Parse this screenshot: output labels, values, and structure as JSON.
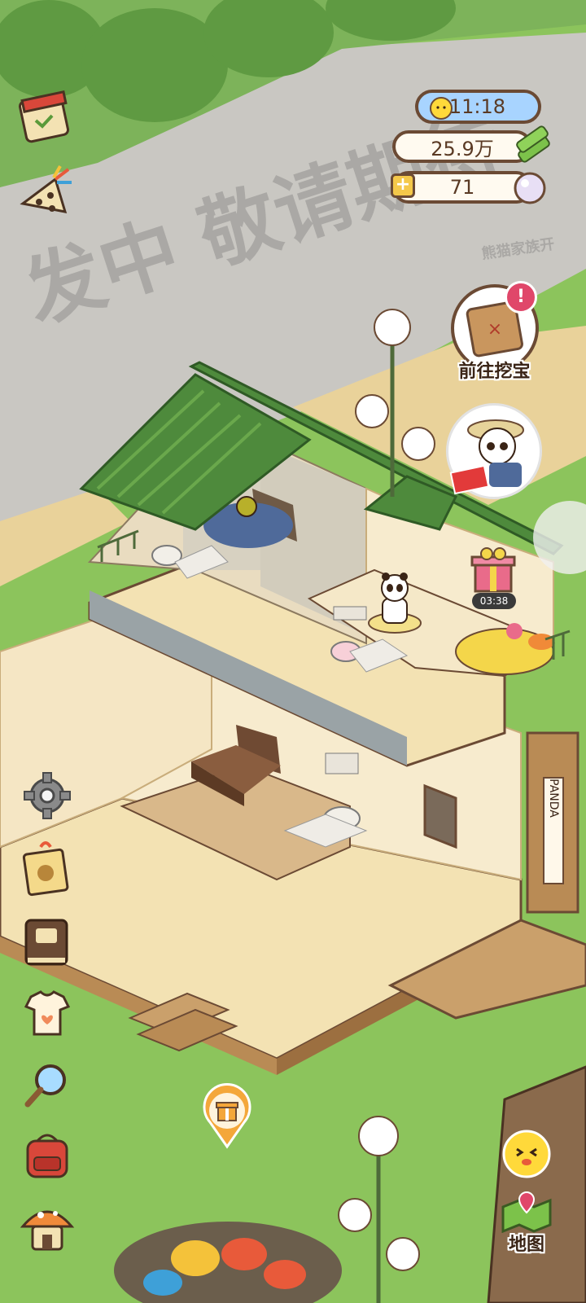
{
  "watermark": {
    "text": "发中 敬请期待",
    "sub": "熊猫家族开"
  },
  "hud": {
    "weather_time": "11:18",
    "bamboo_currency": "25.9万",
    "pearl_currency": "71"
  },
  "treasure": {
    "label": "前往挖宝",
    "alert": "!"
  },
  "gift_timer": "03:38",
  "shop_sign": "PANDA",
  "map_button": {
    "label": "地图"
  },
  "left_menu": [
    "calendar-icon",
    "kite-icon",
    "settings-gear-icon",
    "gift-tag-icon",
    "recipe-book-icon",
    "wardrobe-shirt-icon",
    "search-magnifier-icon",
    "backpack-icon",
    "mushroom-house-icon"
  ],
  "colors": {
    "grass": "#8cc45c",
    "path": "#e9d29a",
    "roof": "#4e8a3c",
    "floor": "#f3e2b3",
    "hud_border": "#6b4a34"
  }
}
